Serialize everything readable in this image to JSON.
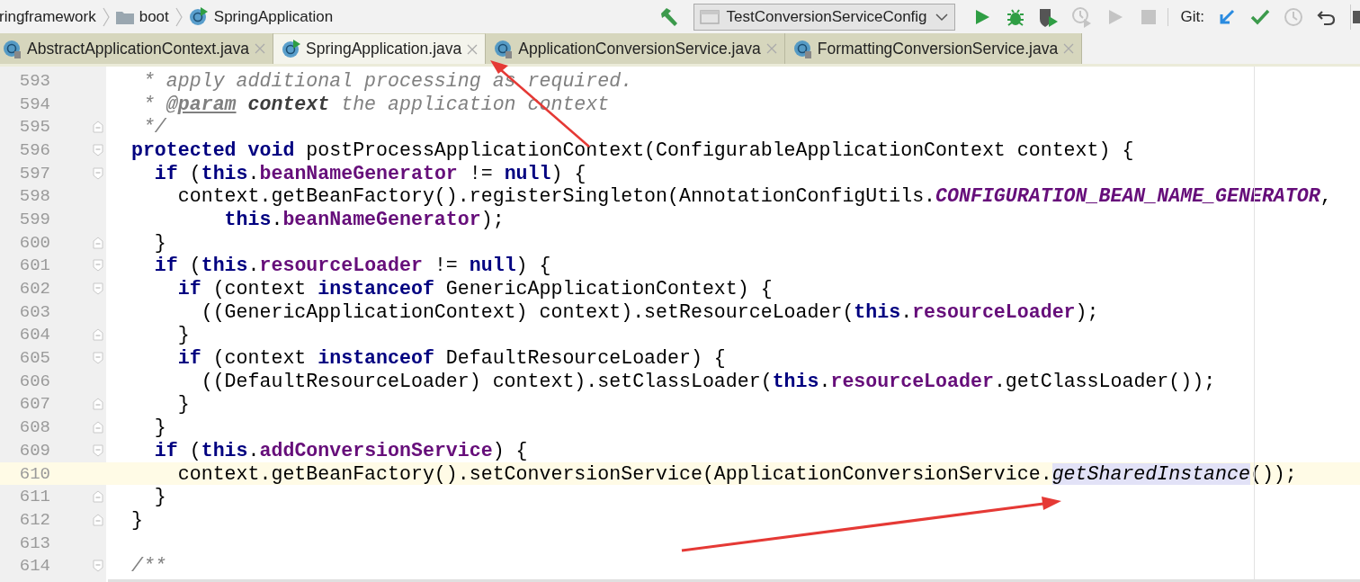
{
  "breadcrumbs": [
    {
      "label": "ringframework"
    },
    {
      "label": "boot"
    },
    {
      "label": "SpringApplication"
    }
  ],
  "toolbar": {
    "run_config": "TestConversionServiceConfig",
    "vcs_label": "Git:",
    "actions": [
      {
        "kind": "build",
        "disabled": false
      },
      {
        "kind": "config"
      },
      {
        "kind": "run",
        "disabled": false
      },
      {
        "kind": "debug",
        "disabled": false
      },
      {
        "kind": "coverage",
        "disabled": false
      },
      {
        "kind": "profile",
        "disabled": true
      },
      {
        "kind": "resume",
        "disabled": true
      },
      {
        "kind": "stop",
        "disabled": true
      },
      {
        "kind": "vcs"
      },
      {
        "kind": "update",
        "disabled": false
      },
      {
        "kind": "commit",
        "disabled": false
      },
      {
        "kind": "history",
        "disabled": true
      },
      {
        "kind": "revert",
        "disabled": false
      },
      {
        "kind": "more",
        "disabled": false
      }
    ]
  },
  "tabs": [
    {
      "label": "AbstractApplicationContext.java",
      "selected": false,
      "runnable": false
    },
    {
      "label": "SpringApplication.java",
      "selected": true,
      "runnable": true
    },
    {
      "label": "ApplicationConversionService.java",
      "selected": false,
      "runnable": false
    },
    {
      "label": "FormattingConversionService.java",
      "selected": false,
      "runnable": false
    }
  ],
  "editor": {
    "lines": [
      {
        "number": "593",
        "fold_start": false,
        "fold_end": false,
        "current": false,
        "tokens": [
          {
            "kind": "comment",
            "text": "   * apply additional processing as required."
          }
        ]
      },
      {
        "number": "594",
        "fold_start": false,
        "fold_end": false,
        "current": false,
        "tokens": [
          {
            "kind": "comment",
            "text": "   * "
          },
          {
            "kind": "doctag",
            "text": "@param"
          },
          {
            "kind": "docparam",
            "text": " context"
          },
          {
            "kind": "comment",
            "text": " the application context"
          }
        ]
      },
      {
        "number": "595",
        "fold_start": false,
        "fold_end": true,
        "current": false,
        "tokens": [
          {
            "kind": "comment",
            "text": "   */"
          }
        ]
      },
      {
        "number": "596",
        "fold_start": true,
        "fold_end": false,
        "current": false,
        "tokens": [
          {
            "kind": "keyword",
            "text": "  protected void "
          },
          {
            "kind": "plain",
            "text": "postProcessApplicationContext(ConfigurableApplicationContext context) {"
          }
        ]
      },
      {
        "number": "597",
        "fold_start": true,
        "fold_end": false,
        "current": false,
        "tokens": [
          {
            "kind": "keyword",
            "text": "    if "
          },
          {
            "kind": "plain",
            "text": "("
          },
          {
            "kind": "keyword",
            "text": "this"
          },
          {
            "kind": "plain",
            "text": "."
          },
          {
            "kind": "field",
            "text": "beanNameGenerator"
          },
          {
            "kind": "plain",
            "text": " != "
          },
          {
            "kind": "keyword",
            "text": "null"
          },
          {
            "kind": "plain",
            "text": ") {"
          }
        ]
      },
      {
        "number": "598",
        "fold_start": false,
        "fold_end": false,
        "current": false,
        "tokens": [
          {
            "kind": "plain",
            "text": "      context.getBeanFactory().registerSingleton(AnnotationConfigUtils."
          },
          {
            "kind": "constant",
            "text": "CONFIGURATION_BEAN_NAME_GENERATOR"
          },
          {
            "kind": "plain",
            "text": ","
          }
        ]
      },
      {
        "number": "599",
        "fold_start": false,
        "fold_end": false,
        "current": false,
        "tokens": [
          {
            "kind": "keyword",
            "text": "          this"
          },
          {
            "kind": "plain",
            "text": "."
          },
          {
            "kind": "field",
            "text": "beanNameGenerator"
          },
          {
            "kind": "plain",
            "text": ");"
          }
        ]
      },
      {
        "number": "600",
        "fold_start": false,
        "fold_end": true,
        "current": false,
        "tokens": [
          {
            "kind": "plain",
            "text": "    }"
          }
        ]
      },
      {
        "number": "601",
        "fold_start": true,
        "fold_end": false,
        "current": false,
        "tokens": [
          {
            "kind": "keyword",
            "text": "    if "
          },
          {
            "kind": "plain",
            "text": "("
          },
          {
            "kind": "keyword",
            "text": "this"
          },
          {
            "kind": "plain",
            "text": "."
          },
          {
            "kind": "field",
            "text": "resourceLoader"
          },
          {
            "kind": "plain",
            "text": " != "
          },
          {
            "kind": "keyword",
            "text": "null"
          },
          {
            "kind": "plain",
            "text": ") {"
          }
        ]
      },
      {
        "number": "602",
        "fold_start": true,
        "fold_end": false,
        "current": false,
        "tokens": [
          {
            "kind": "keyword",
            "text": "      if "
          },
          {
            "kind": "plain",
            "text": "(context "
          },
          {
            "kind": "keyword",
            "text": "instanceof "
          },
          {
            "kind": "plain",
            "text": "GenericApplicationContext) {"
          }
        ]
      },
      {
        "number": "603",
        "fold_start": false,
        "fold_end": false,
        "current": false,
        "tokens": [
          {
            "kind": "plain",
            "text": "        ((GenericApplicationContext) context).setResourceLoader("
          },
          {
            "kind": "keyword",
            "text": "this"
          },
          {
            "kind": "plain",
            "text": "."
          },
          {
            "kind": "field",
            "text": "resourceLoader"
          },
          {
            "kind": "plain",
            "text": ");"
          }
        ]
      },
      {
        "number": "604",
        "fold_start": false,
        "fold_end": true,
        "current": false,
        "tokens": [
          {
            "kind": "plain",
            "text": "      }"
          }
        ]
      },
      {
        "number": "605",
        "fold_start": true,
        "fold_end": false,
        "current": false,
        "tokens": [
          {
            "kind": "keyword",
            "text": "      if "
          },
          {
            "kind": "plain",
            "text": "(context "
          },
          {
            "kind": "keyword",
            "text": "instanceof "
          },
          {
            "kind": "plain",
            "text": "DefaultResourceLoader) {"
          }
        ]
      },
      {
        "number": "606",
        "fold_start": false,
        "fold_end": false,
        "current": false,
        "tokens": [
          {
            "kind": "plain",
            "text": "        ((DefaultResourceLoader) context).setClassLoader("
          },
          {
            "kind": "keyword",
            "text": "this"
          },
          {
            "kind": "plain",
            "text": "."
          },
          {
            "kind": "field",
            "text": "resourceLoader"
          },
          {
            "kind": "plain",
            "text": ".getClassLoader());"
          }
        ]
      },
      {
        "number": "607",
        "fold_start": false,
        "fold_end": true,
        "current": false,
        "tokens": [
          {
            "kind": "plain",
            "text": "      }"
          }
        ]
      },
      {
        "number": "608",
        "fold_start": false,
        "fold_end": true,
        "current": false,
        "tokens": [
          {
            "kind": "plain",
            "text": "    }"
          }
        ]
      },
      {
        "number": "609",
        "fold_start": true,
        "fold_end": false,
        "current": false,
        "tokens": [
          {
            "kind": "keyword",
            "text": "    if "
          },
          {
            "kind": "plain",
            "text": "("
          },
          {
            "kind": "keyword",
            "text": "this"
          },
          {
            "kind": "plain",
            "text": "."
          },
          {
            "kind": "field",
            "text": "addConversionService"
          },
          {
            "kind": "plain",
            "text": ") {"
          }
        ]
      },
      {
        "number": "610",
        "fold_start": false,
        "fold_end": false,
        "current": true,
        "tokens": [
          {
            "kind": "plain",
            "text": "      context.getBeanFactory().setConversionService(ApplicationConversionService."
          },
          {
            "kind": "match",
            "text": "getSharedInstance"
          },
          {
            "kind": "plain",
            "text": "());"
          }
        ]
      },
      {
        "number": "611",
        "fold_start": false,
        "fold_end": true,
        "current": false,
        "tokens": [
          {
            "kind": "plain",
            "text": "    }"
          }
        ]
      },
      {
        "number": "612",
        "fold_start": false,
        "fold_end": true,
        "current": false,
        "tokens": [
          {
            "kind": "plain",
            "text": "  }"
          }
        ]
      },
      {
        "number": "613",
        "fold_start": false,
        "fold_end": false,
        "current": false
      },
      {
        "number": "614",
        "fold_start": true,
        "fold_end": false,
        "current": false,
        "tokens": [
          {
            "kind": "comment",
            "text": "  /**"
          }
        ]
      }
    ]
  }
}
